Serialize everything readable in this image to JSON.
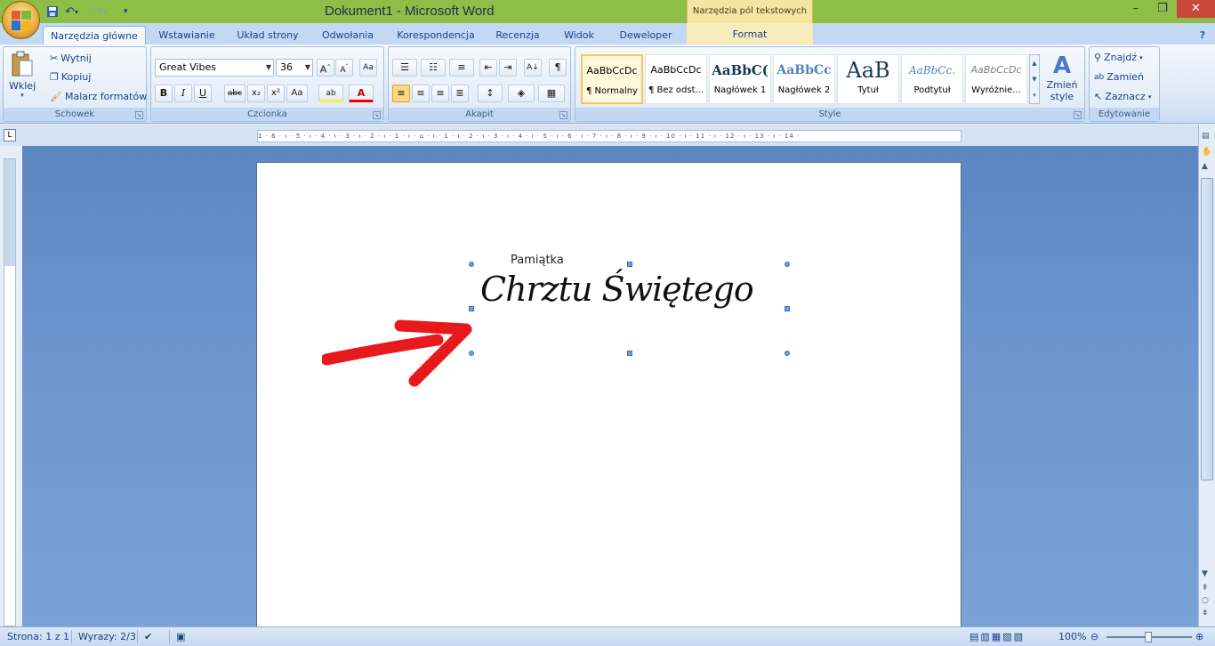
{
  "titlebar": {
    "title": "Dokument1 - Microsoft Word",
    "context_tools": "Narzędzia pól tekstowych",
    "undo_icon": "undo-icon",
    "redo_icon": "redo-icon",
    "save_icon": "save-icon",
    "close": "✕",
    "minimize": "–",
    "maximize": "❐"
  },
  "tabs": [
    "Narzędzia główne",
    "Wstawianie",
    "Układ strony",
    "Odwołania",
    "Korespondencja",
    "Recenzja",
    "Widok",
    "Deweloper",
    "Format"
  ],
  "clipboard": {
    "paste": "Wklej",
    "cut": "Wytnij",
    "copy": "Kopiuj",
    "painter": "Malarz formatów",
    "label": "Schowek"
  },
  "font": {
    "name": "Great Vibes",
    "size": "36",
    "label": "Czcionka"
  },
  "paragraph": {
    "label": "Akapit"
  },
  "styles": {
    "items": [
      {
        "preview": "AaBbCcDc",
        "name": "¶ Normalny"
      },
      {
        "preview": "AaBbCcDc",
        "name": "¶ Bez odst..."
      },
      {
        "preview": "AaBbC(",
        "name": "Nagłówek 1"
      },
      {
        "preview": "AaBbCc",
        "name": "Nagłówek 2"
      },
      {
        "preview": "AaB",
        "name": "Tytuł"
      },
      {
        "preview": "AaBbCc.",
        "name": "Podtytuł"
      },
      {
        "preview": "AaBbCcDc",
        "name": "Wyróżnie..."
      }
    ],
    "change": "Zmień",
    "change2": "style",
    "label": "Style"
  },
  "editing": {
    "find": "Znajdź",
    "replace": "Zamień",
    "select": "Zaznacz",
    "label": "Edytowanie"
  },
  "ruler_text": "1 · 6 · ı · 5 · ı · 4 · ı · 3 · ı · 2 · ı · 1 · ı · ⌂ · ı · 1 · ı · 2 · ı · 3 · ı · 4 · ı · 5 · ı · 6 · ı · 7 · ı · 8 · ı · 9 · ı · 10 · ı · 11 · ı · 12 · ı · 13 · ı · 14 ·",
  "document": {
    "small_text": "Pamiątka",
    "script_text": "Chrztu Świętego"
  },
  "status": {
    "page": "Strona: 1 z 1",
    "words": "Wyrazy: 2/3",
    "zoom": "100%"
  },
  "colors": {
    "titlebar": "#8fbe47",
    "ribbon": "#dbe7f6",
    "doc_bg": "#6b95cc",
    "arrow": "#e8191c"
  }
}
